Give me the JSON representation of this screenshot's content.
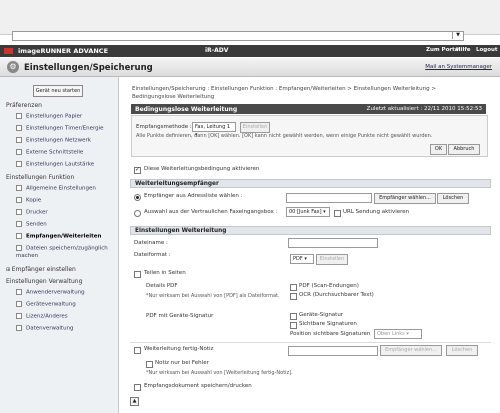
{
  "header": {
    "brand": "imageRUNNER ADVANCE",
    "model": "iR-ADV",
    "links": [
      "Zum Portal",
      "Hilfe",
      "Logout"
    ]
  },
  "title_bar": {
    "title": "Einstellungen/Speicherung",
    "mail_link": "Mail an Systemmanager"
  },
  "sidebar": {
    "restart_button": "Gerät neu starten",
    "sections": [
      {
        "label": "Präferenzen",
        "items": [
          "Einstellungen Papier",
          "Einstellungen Timer/Energie",
          "Einstellungen Netzwerk",
          "Externe Schnittstelle",
          "Einstellungen Lautstärke"
        ]
      },
      {
        "label": "Einstellungen Funktion",
        "items": [
          "Allgemeine Einstellungen",
          "Kopie",
          "Drucker",
          "Senden",
          "Empfangen/Weiterleiten",
          "Dateien speichern/zugänglich machen"
        ]
      },
      {
        "label": "Empfänger einstellen",
        "items": []
      },
      {
        "label": "Einstellungen Verwaltung",
        "items": [
          "Anwenderverwaltung",
          "Geräteverwaltung",
          "Lizenz/Anderes",
          "Datenverwaltung"
        ]
      }
    ],
    "active_item": "Empfangen/Weiterleiten"
  },
  "breadcrumb": {
    "line1": "Einstellungen/Speicherung : Einstellungen Funktion : Empfangen/Weiterleiten > Einstellungen Weiterleitung >",
    "line2": "Bedingungslose Weiterleitung"
  },
  "panel": {
    "title": "Bedingungslose Weiterleitung",
    "last_updated": "Zuletzt aktualisiert : 22/11 2010 15:52:53",
    "receive_method_label": "Empfangsmethode :",
    "receive_method_value": "Fax, Leitung 1",
    "select_button": "Einstellen",
    "instruction": "Alle Punkte definieren, dann [OK] wählen. [OK] kann nicht gewählt werden, wenn einige Punkte nicht gewählt wurden.",
    "ok_button": "OK",
    "cancel_button": "Abbruch"
  },
  "activate": {
    "label": "Diese Weiterleitungsbedingung aktivieren",
    "checked": true
  },
  "recipient": {
    "header": "Weiterleitungsempfänger",
    "option1_label": "Empfänger aus Adressliste wählen :",
    "option1_selected": true,
    "select_recipient_button": "Empfänger wählen...",
    "delete_button": "Löschen",
    "option2_label": "Auswahl aus der Vertraulichen Faxeingangsbox :",
    "inbox_value": "00 [Junk Fax]",
    "url_label": "URL Sendung aktivieren"
  },
  "forward_settings": {
    "header": "Einstellungen Weiterleitung",
    "filename_label": "Dateiname :",
    "filename_value": "",
    "format_label": "Dateiformat :",
    "format_value": "PDF",
    "format_button": "Einstellen",
    "split_pages_label": "Teilen in Seiten",
    "pdf_details_label": "Details PDF",
    "pdf_details_note": "*Nur wirksam bei Auswahl von [PDF] als Dateiformat.",
    "pdf_scan_label": "PDF (Scan-Endungen)",
    "ocr_label": "OCR (Durchsuchbarer Text)",
    "signature_label": "PDF mit Geräte-Signatur",
    "device_signature_label": "Geräte-Signatur",
    "visible_signatures_label": "Sichtbare Signaturen",
    "position_label": "Position sichtbare Signaturen",
    "position_value": "Oben Links",
    "notify_label": "Weiterleitung fertig-Notiz",
    "notify_select_button": "Empfänger wählen...",
    "notify_delete_button": "Löschen",
    "notify_error_label": "Notiz nur bei Fehler",
    "notify_note": "*Nur wirksam bei Auswahl von [Weiterleitung fertig-Notiz].",
    "save_print_label": "Empfangsdokument speichern/drucken"
  }
}
